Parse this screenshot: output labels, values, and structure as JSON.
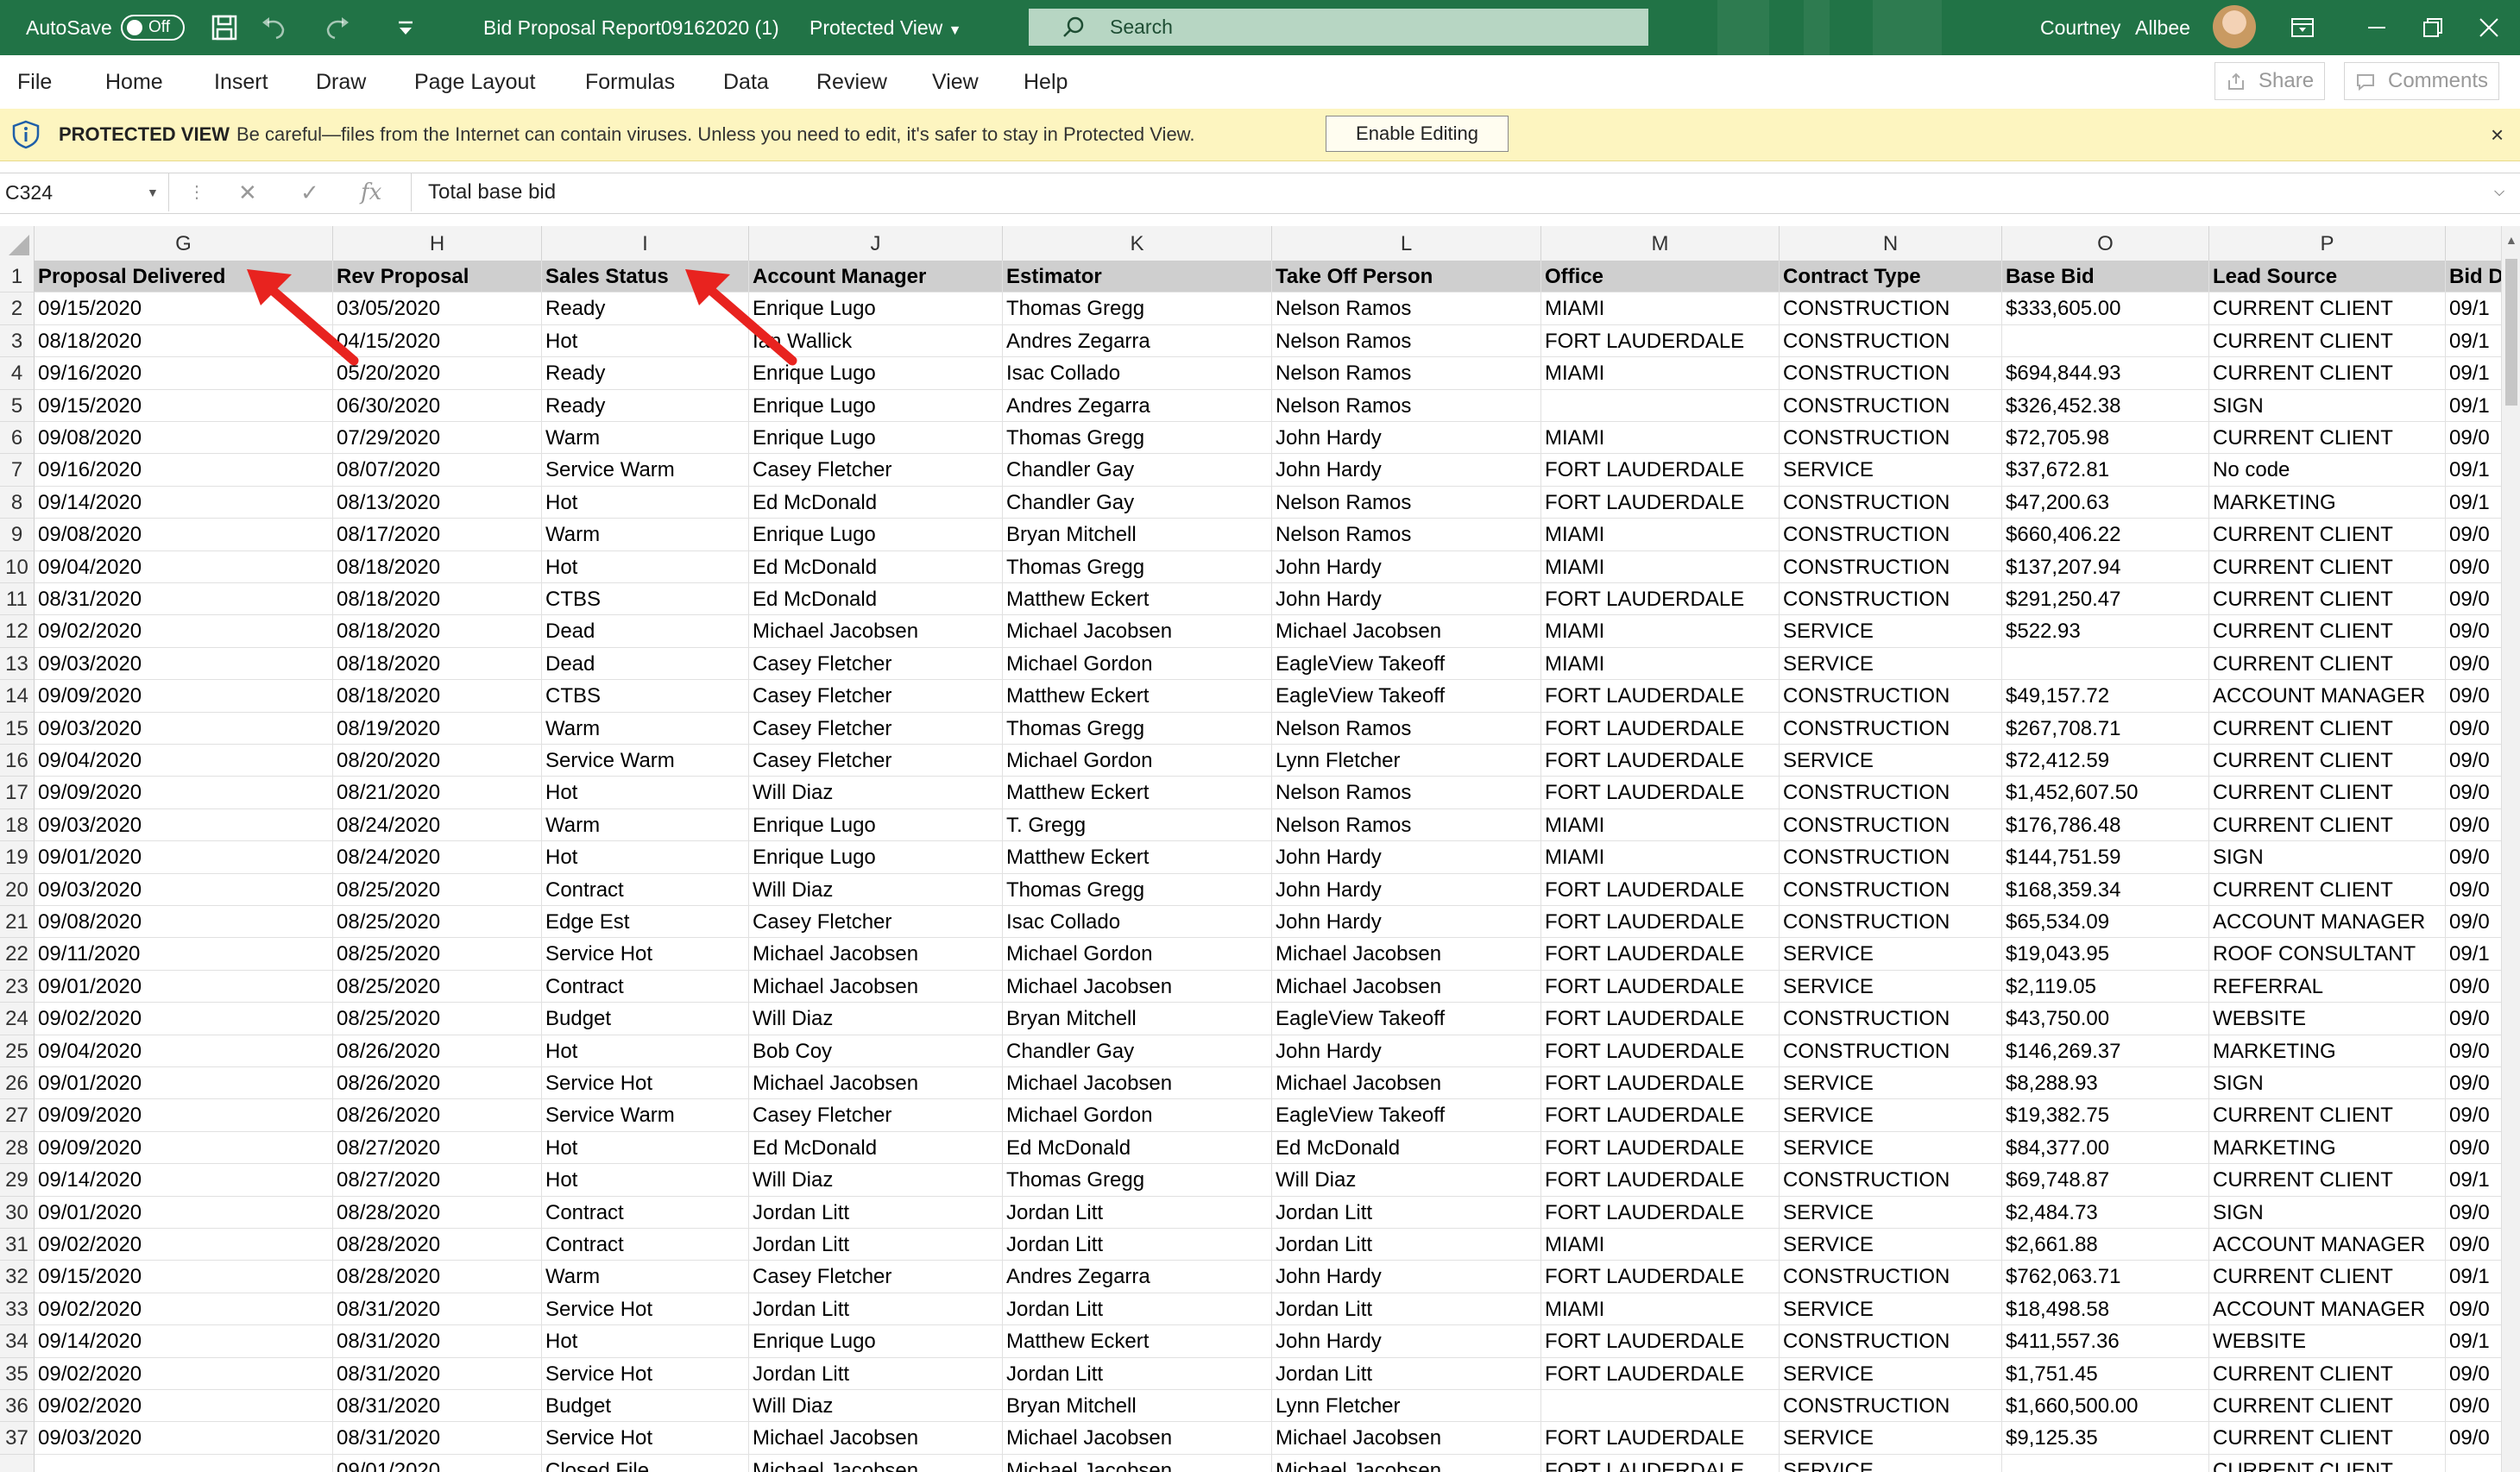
{
  "titlebar": {
    "autosave_label": "AutoSave",
    "autosave_state": "Off",
    "document_title": "Bid Proposal Report09162020 (1)",
    "view_mode": "Protected View",
    "search_placeholder": "Search",
    "user_first": "Courtney",
    "user_last": "Allbee"
  },
  "ribbon": {
    "tabs": [
      "File",
      "Home",
      "Insert",
      "Draw",
      "Page Layout",
      "Formulas",
      "Data",
      "Review",
      "View",
      "Help"
    ],
    "share_label": "Share",
    "comments_label": "Comments"
  },
  "protected_bar": {
    "title": "PROTECTED VIEW",
    "message": "Be careful—files from the Internet can contain viruses. Unless you need to edit, it's safer to stay in Protected View.",
    "button": "Enable Editing",
    "close": "×"
  },
  "formula_bar": {
    "name_box": "C324",
    "fx_label": "fx",
    "value": "Total base bid"
  },
  "sheet": {
    "columns": [
      "G",
      "H",
      "I",
      "J",
      "K",
      "L",
      "M",
      "N",
      "O",
      "P",
      ""
    ],
    "header_row": {
      "num": "1",
      "cells": [
        "Proposal Delivered",
        "Rev Proposal",
        "Sales Status",
        "Account Manager",
        "Estimator",
        "Take Off Person",
        "Office",
        "Contract Type",
        "Base Bid",
        "Lead Source",
        "Bid D"
      ]
    },
    "rows": [
      {
        "num": "2",
        "cells": [
          "09/15/2020",
          "03/05/2020",
          "Ready",
          "Enrique Lugo",
          "Thomas Gregg",
          "Nelson Ramos",
          "MIAMI",
          "CONSTRUCTION",
          "$333,605.00",
          "CURRENT CLIENT",
          "09/1"
        ]
      },
      {
        "num": "3",
        "cells": [
          "08/18/2020",
          "04/15/2020",
          "Hot",
          "Ian Wallick",
          "Andres Zegarra",
          "Nelson Ramos",
          "FORT LAUDERDALE",
          "CONSTRUCTION",
          "",
          "CURRENT CLIENT",
          "09/1"
        ]
      },
      {
        "num": "4",
        "cells": [
          "09/16/2020",
          "05/20/2020",
          "Ready",
          "Enrique Lugo",
          "Isac Collado",
          "Nelson Ramos",
          "MIAMI",
          "CONSTRUCTION",
          "$694,844.93",
          "CURRENT CLIENT",
          "09/1"
        ]
      },
      {
        "num": "5",
        "cells": [
          "09/15/2020",
          "06/30/2020",
          "Ready",
          "Enrique Lugo",
          "Andres Zegarra",
          "Nelson Ramos",
          "",
          "CONSTRUCTION",
          "$326,452.38",
          "SIGN",
          "09/1"
        ]
      },
      {
        "num": "6",
        "cells": [
          "09/08/2020",
          "07/29/2020",
          "Warm",
          "Enrique Lugo",
          "Thomas Gregg",
          "John Hardy",
          "MIAMI",
          "CONSTRUCTION",
          "$72,705.98",
          "CURRENT CLIENT",
          "09/0"
        ]
      },
      {
        "num": "7",
        "cells": [
          "09/16/2020",
          "08/07/2020",
          "Service Warm",
          "Casey Fletcher",
          "Chandler Gay",
          "John Hardy",
          "FORT LAUDERDALE",
          "SERVICE",
          "$37,672.81",
          "No code",
          "09/1"
        ]
      },
      {
        "num": "8",
        "cells": [
          "09/14/2020",
          "08/13/2020",
          "Hot",
          "Ed McDonald",
          "Chandler Gay",
          "Nelson Ramos",
          "FORT LAUDERDALE",
          "CONSTRUCTION",
          "$47,200.63",
          "MARKETING",
          "09/1"
        ]
      },
      {
        "num": "9",
        "cells": [
          "09/08/2020",
          "08/17/2020",
          "Warm",
          "Enrique Lugo",
          "Bryan Mitchell",
          "Nelson Ramos",
          "MIAMI",
          "CONSTRUCTION",
          "$660,406.22",
          "CURRENT CLIENT",
          "09/0"
        ]
      },
      {
        "num": "10",
        "cells": [
          "09/04/2020",
          "08/18/2020",
          "Hot",
          "Ed McDonald",
          "Thomas Gregg",
          "John Hardy",
          "MIAMI",
          "CONSTRUCTION",
          "$137,207.94",
          "CURRENT CLIENT",
          "09/0"
        ]
      },
      {
        "num": "11",
        "cells": [
          "08/31/2020",
          "08/18/2020",
          "CTBS",
          "Ed McDonald",
          "Matthew Eckert",
          "John Hardy",
          "FORT LAUDERDALE",
          "CONSTRUCTION",
          "$291,250.47",
          "CURRENT CLIENT",
          "09/0"
        ]
      },
      {
        "num": "12",
        "cells": [
          "09/02/2020",
          "08/18/2020",
          "Dead",
          "Michael Jacobsen",
          "Michael Jacobsen",
          "Michael Jacobsen",
          "MIAMI",
          "SERVICE",
          "$522.93",
          "CURRENT CLIENT",
          "09/0"
        ]
      },
      {
        "num": "13",
        "cells": [
          "09/03/2020",
          "08/18/2020",
          "Dead",
          "Casey Fletcher",
          "Michael Gordon",
          "EagleView Takeoff",
          "MIAMI",
          "SERVICE",
          "",
          "CURRENT CLIENT",
          "09/0"
        ]
      },
      {
        "num": "14",
        "cells": [
          "09/09/2020",
          "08/18/2020",
          "CTBS",
          "Casey Fletcher",
          "Matthew Eckert",
          "EagleView Takeoff",
          "FORT LAUDERDALE",
          "CONSTRUCTION",
          "$49,157.72",
          "ACCOUNT MANAGER",
          "09/0"
        ]
      },
      {
        "num": "15",
        "cells": [
          "09/03/2020",
          "08/19/2020",
          "Warm",
          "Casey Fletcher",
          "Thomas Gregg",
          "Nelson Ramos",
          "FORT LAUDERDALE",
          "CONSTRUCTION",
          "$267,708.71",
          "CURRENT CLIENT",
          "09/0"
        ]
      },
      {
        "num": "16",
        "cells": [
          "09/04/2020",
          "08/20/2020",
          "Service Warm",
          "Casey Fletcher",
          "Michael Gordon",
          "Lynn Fletcher",
          "FORT LAUDERDALE",
          "SERVICE",
          "$72,412.59",
          "CURRENT CLIENT",
          "09/0"
        ]
      },
      {
        "num": "17",
        "cells": [
          "09/09/2020",
          "08/21/2020",
          "Hot",
          "Will Diaz",
          "Matthew Eckert",
          "Nelson Ramos",
          "FORT LAUDERDALE",
          "CONSTRUCTION",
          "$1,452,607.50",
          "CURRENT CLIENT",
          "09/0"
        ]
      },
      {
        "num": "18",
        "cells": [
          "09/03/2020",
          "08/24/2020",
          "Warm",
          "Enrique Lugo",
          "T. Gregg",
          "Nelson Ramos",
          "MIAMI",
          "CONSTRUCTION",
          "$176,786.48",
          "CURRENT CLIENT",
          "09/0"
        ]
      },
      {
        "num": "19",
        "cells": [
          "09/01/2020",
          "08/24/2020",
          "Hot",
          "Enrique Lugo",
          "Matthew Eckert",
          "John Hardy",
          "MIAMI",
          "CONSTRUCTION",
          "$144,751.59",
          "SIGN",
          "09/0"
        ]
      },
      {
        "num": "20",
        "cells": [
          "09/03/2020",
          "08/25/2020",
          "Contract",
          "Will Diaz",
          "Thomas Gregg",
          "John Hardy",
          "FORT LAUDERDALE",
          "CONSTRUCTION",
          "$168,359.34",
          "CURRENT CLIENT",
          "09/0"
        ]
      },
      {
        "num": "21",
        "cells": [
          "09/08/2020",
          "08/25/2020",
          "Edge Est",
          "Casey Fletcher",
          "Isac Collado",
          "John Hardy",
          "FORT LAUDERDALE",
          "CONSTRUCTION",
          "$65,534.09",
          "ACCOUNT MANAGER",
          "09/0"
        ]
      },
      {
        "num": "22",
        "cells": [
          "09/11/2020",
          "08/25/2020",
          "Service Hot",
          "Michael Jacobsen",
          "Michael Gordon",
          "Michael Jacobsen",
          "FORT LAUDERDALE",
          "SERVICE",
          "$19,043.95",
          "ROOF CONSULTANT",
          "09/1"
        ]
      },
      {
        "num": "23",
        "cells": [
          "09/01/2020",
          "08/25/2020",
          "Contract",
          "Michael Jacobsen",
          "Michael Jacobsen",
          "Michael Jacobsen",
          "FORT LAUDERDALE",
          "SERVICE",
          "$2,119.05",
          "REFERRAL",
          "09/0"
        ]
      },
      {
        "num": "24",
        "cells": [
          "09/02/2020",
          "08/25/2020",
          "Budget",
          "Will Diaz",
          "Bryan Mitchell",
          "EagleView Takeoff",
          "FORT LAUDERDALE",
          "CONSTRUCTION",
          "$43,750.00",
          "WEBSITE",
          "09/0"
        ]
      },
      {
        "num": "25",
        "cells": [
          "09/04/2020",
          "08/26/2020",
          "Hot",
          "Bob Coy",
          "Chandler Gay",
          "John Hardy",
          "FORT LAUDERDALE",
          "CONSTRUCTION",
          "$146,269.37",
          "MARKETING",
          "09/0"
        ]
      },
      {
        "num": "26",
        "cells": [
          "09/01/2020",
          "08/26/2020",
          "Service Hot",
          "Michael Jacobsen",
          "Michael Jacobsen",
          "Michael Jacobsen",
          "FORT LAUDERDALE",
          "SERVICE",
          "$8,288.93",
          "SIGN",
          "09/0"
        ]
      },
      {
        "num": "27",
        "cells": [
          "09/09/2020",
          "08/26/2020",
          "Service Warm",
          "Casey Fletcher",
          "Michael Gordon",
          "EagleView Takeoff",
          "FORT LAUDERDALE",
          "SERVICE",
          "$19,382.75",
          "CURRENT CLIENT",
          "09/0"
        ]
      },
      {
        "num": "28",
        "cells": [
          "09/09/2020",
          "08/27/2020",
          "Hot",
          "Ed McDonald",
          "Ed McDonald",
          "Ed McDonald",
          "FORT LAUDERDALE",
          "SERVICE",
          "$84,377.00",
          "MARKETING",
          "09/0"
        ]
      },
      {
        "num": "29",
        "cells": [
          "09/14/2020",
          "08/27/2020",
          "Hot",
          "Will Diaz",
          "Thomas Gregg",
          "Will Diaz",
          "FORT LAUDERDALE",
          "CONSTRUCTION",
          "$69,748.87",
          "CURRENT CLIENT",
          "09/1"
        ]
      },
      {
        "num": "30",
        "cells": [
          "09/01/2020",
          "08/28/2020",
          "Contract",
          "Jordan Litt",
          "Jordan Litt",
          "Jordan Litt",
          "FORT LAUDERDALE",
          "SERVICE",
          "$2,484.73",
          "SIGN",
          "09/0"
        ]
      },
      {
        "num": "31",
        "cells": [
          "09/02/2020",
          "08/28/2020",
          "Contract",
          "Jordan Litt",
          "Jordan Litt",
          "Jordan Litt",
          "MIAMI",
          "SERVICE",
          "$2,661.88",
          "ACCOUNT MANAGER",
          "09/0"
        ]
      },
      {
        "num": "32",
        "cells": [
          "09/15/2020",
          "08/28/2020",
          "Warm",
          "Casey Fletcher",
          "Andres Zegarra",
          "John Hardy",
          "FORT LAUDERDALE",
          "CONSTRUCTION",
          "$762,063.71",
          "CURRENT CLIENT",
          "09/1"
        ]
      },
      {
        "num": "33",
        "cells": [
          "09/02/2020",
          "08/31/2020",
          "Service Hot",
          "Jordan Litt",
          "Jordan Litt",
          "Jordan Litt",
          "MIAMI",
          "SERVICE",
          "$18,498.58",
          "ACCOUNT MANAGER",
          "09/0"
        ]
      },
      {
        "num": "34",
        "cells": [
          "09/14/2020",
          "08/31/2020",
          "Hot",
          "Enrique Lugo",
          "Matthew Eckert",
          "John Hardy",
          "FORT LAUDERDALE",
          "CONSTRUCTION",
          "$411,557.36",
          "WEBSITE",
          "09/1"
        ]
      },
      {
        "num": "35",
        "cells": [
          "09/02/2020",
          "08/31/2020",
          "Service Hot",
          "Jordan Litt",
          "Jordan Litt",
          "Jordan Litt",
          "FORT LAUDERDALE",
          "SERVICE",
          "$1,751.45",
          "CURRENT CLIENT",
          "09/0"
        ]
      },
      {
        "num": "36",
        "cells": [
          "09/02/2020",
          "08/31/2020",
          "Budget",
          "Will Diaz",
          "Bryan Mitchell",
          "Lynn Fletcher",
          "",
          "CONSTRUCTION",
          "$1,660,500.00",
          "CURRENT CLIENT",
          "09/0"
        ]
      },
      {
        "num": "37",
        "cells": [
          "09/03/2020",
          "08/31/2020",
          "Service Hot",
          "Michael Jacobsen",
          "Michael Jacobsen",
          "Michael Jacobsen",
          "FORT LAUDERDALE",
          "SERVICE",
          "$9,125.35",
          "CURRENT CLIENT",
          "09/0"
        ]
      },
      {
        "num": "",
        "cells": [
          "",
          "09/01/2020",
          "Closed File",
          "Michael Jacobsen",
          "Michael Jacobsen",
          "Michael Jacobsen",
          "FORT LAUDERDALE",
          "SERVICE",
          "",
          "CURRENT CLIENT",
          ""
        ]
      }
    ]
  },
  "colors": {
    "titlebar": "#217346",
    "protected_bar": "#fdf5c0",
    "header_fill": "#cfcfcf",
    "annotation_arrow": "#e8231f"
  },
  "icons": [
    "save-icon",
    "undo-icon",
    "redo-icon",
    "customize-icon",
    "search-icon",
    "ribbon-display-icon",
    "minimize-icon",
    "restore-icon",
    "close-icon",
    "shield-icon",
    "share-icon",
    "comment-icon",
    "chevron-down-icon"
  ]
}
